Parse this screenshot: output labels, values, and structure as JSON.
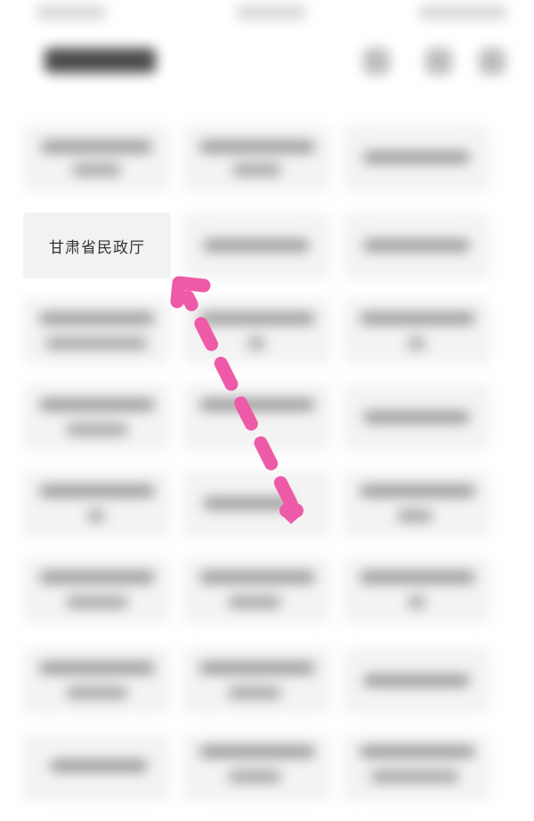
{
  "focused_item": {
    "label": "甘肃省民政厅"
  },
  "annotation": {
    "color": "#ef5aa8"
  }
}
